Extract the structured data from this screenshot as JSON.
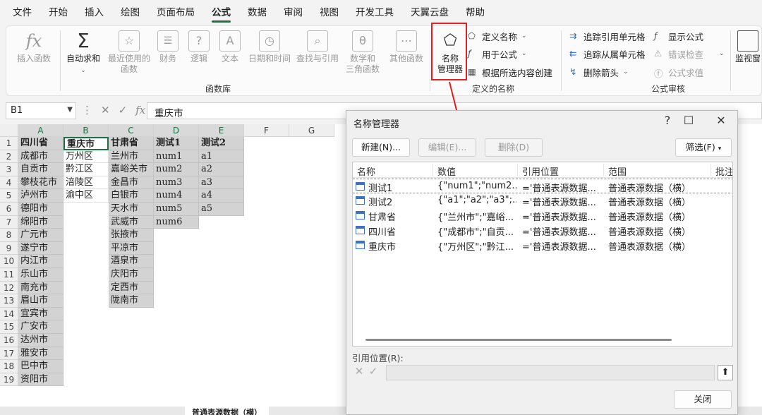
{
  "menu": [
    "文件",
    "开始",
    "插入",
    "绘图",
    "页面布局",
    "公式",
    "数据",
    "审阅",
    "视图",
    "开发工具",
    "天翼云盘",
    "帮助"
  ],
  "ribbon": {
    "insert_function": "插入函数",
    "autosum": "自动求和",
    "recent": [
      "最近使用的",
      "函数"
    ],
    "finance": "财务",
    "logic": "逻辑",
    "text": "文本",
    "datetime": "日期和时间",
    "lookup": "查找与引用",
    "math": [
      "数学和",
      "三角函数"
    ],
    "other": "其他函数",
    "group_library": "函数库",
    "name_manager": [
      "名称",
      "管理器"
    ],
    "define_name": "定义名称",
    "use_in_formula": "用于公式",
    "create_from_sel": "根据所选内容创建",
    "group_defined": "定义的名称",
    "trace_prec": "追踪引用单元格",
    "trace_dep": "追踪从属单元格",
    "remove_arrows": "删除箭头",
    "show_formula": "显示公式",
    "error_check": "错误检查",
    "evaluate": "公式求值",
    "group_audit": "公式审核",
    "watch": "监视窗"
  },
  "formula_bar": {
    "name_box": "B1",
    "fx": "fx",
    "value": "重庆市"
  },
  "columns": [
    "A",
    "B",
    "C",
    "D",
    "E",
    "F",
    "G"
  ],
  "rows": [
    "1",
    "2",
    "3",
    "4",
    "5",
    "6",
    "7",
    "8",
    "9",
    "10",
    "11",
    "12",
    "13",
    "14",
    "15",
    "16",
    "17",
    "18",
    "19"
  ],
  "colA": [
    "四川省",
    "成都市",
    "自贡市",
    "攀枝花市",
    "泸州市",
    "德阳市",
    "绵阳市",
    "广元市",
    "遂宁市",
    "内江市",
    "乐山市",
    "南充市",
    "眉山市",
    "宜宾市",
    "广安市",
    "达州市",
    "雅安市",
    "巴中市",
    "资阳市"
  ],
  "colB": [
    "重庆市",
    "万州区",
    "黔江区",
    "涪陵区",
    "渝中区"
  ],
  "colC": [
    "甘肃省",
    "兰州市",
    "嘉峪关市",
    "金昌市",
    "白银市",
    "天水市",
    "武威市",
    "张掖市",
    "平凉市",
    "酒泉市",
    "庆阳市",
    "定西市",
    "陇南市"
  ],
  "colD": [
    "测试1",
    "num1",
    "num2",
    "num3",
    "num4",
    "num5",
    "num6"
  ],
  "colE": [
    "测试2",
    "a1",
    "a2",
    "a3",
    "a4",
    "a5"
  ],
  "sheet_tabs": {
    "active": "普通表源数据（横）"
  },
  "dialog": {
    "title": "名称管理器",
    "new_btn": "新建(N)...",
    "edit_btn": "编辑(E)...",
    "delete_btn": "删除(D)",
    "filter_btn": "筛选(F)",
    "headers": [
      "名称",
      "数值",
      "引用位置",
      "范围",
      "批注"
    ],
    "rows": [
      {
        "name": "测试1",
        "value": "{\"num1\";\"num2...",
        "ref": "='普通表源数据...",
        "scope": "普通表源数据（横）"
      },
      {
        "name": "测试2",
        "value": "{\"a1\";\"a2\";\"a3\";...",
        "ref": "='普通表源数据...",
        "scope": "普通表源数据（横）"
      },
      {
        "name": "甘肃省",
        "value": "{\"兰州市\";\"嘉峪...",
        "ref": "='普通表源数据...",
        "scope": "普通表源数据（横）"
      },
      {
        "name": "四川省",
        "value": "{\"成都市\";\"自贡...",
        "ref": "='普通表源数据...",
        "scope": "普通表源数据（横）"
      },
      {
        "name": "重庆市",
        "value": "{\"万州区\";\"黔江...",
        "ref": "='普通表源数据...",
        "scope": "普通表源数据（横）"
      }
    ],
    "ref_label": "引用位置(R):",
    "close_btn": "关闭"
  },
  "colors": {
    "accent": "#1e7145",
    "highlight": "#e02020"
  }
}
